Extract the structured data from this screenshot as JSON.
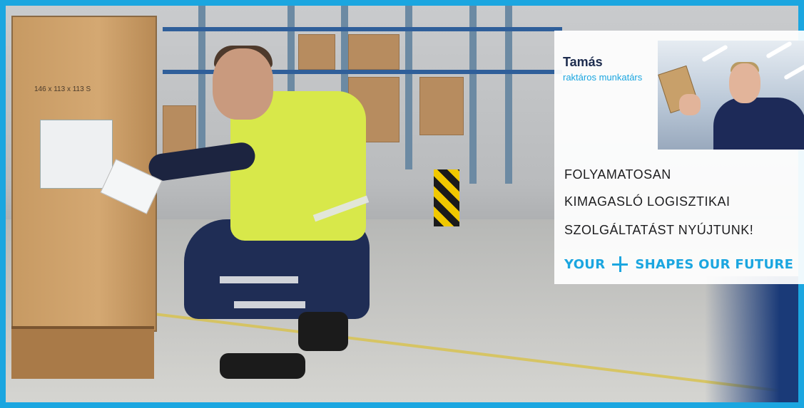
{
  "colors": {
    "frame": "#1ba6e0",
    "accent": "#1ba6e0",
    "name": "#1d2c4e",
    "text": "#1d1d1f"
  },
  "person": {
    "name": "Tamás",
    "role": "raktáros munkatárs"
  },
  "headline": {
    "line1": "FOLYAMATOSAN",
    "line2": "KIMAGASLÓ LOGISZTIKAI",
    "line3": "SZOLGÁLTATÁST NYÚJTUNK!"
  },
  "slogan": {
    "left": "YOUR",
    "icon": "plus-icon",
    "right": "SHAPES OUR FUTURE"
  },
  "crate": {
    "marking": "146 x 113 x 113 S"
  }
}
